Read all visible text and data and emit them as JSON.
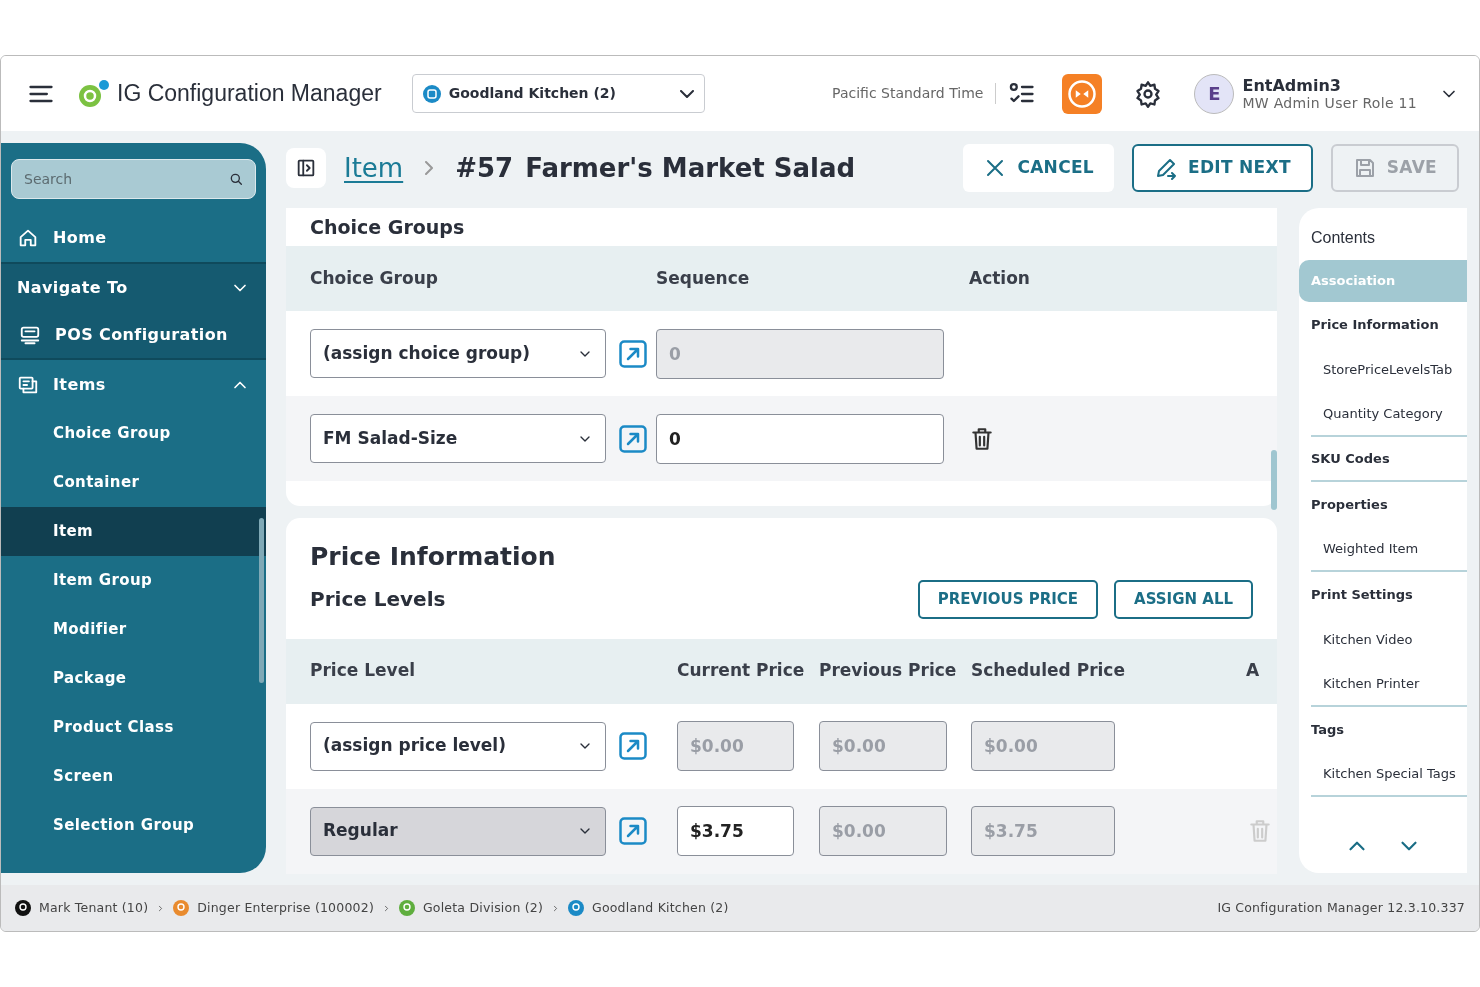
{
  "app": {
    "title": "IG Configuration Manager"
  },
  "location_select": {
    "value": "Goodland Kitchen (2)"
  },
  "timezone": "Pacific Standard Time",
  "user": {
    "initial": "E",
    "name": "EntAdmin3",
    "role": "MW Admin User Role 11"
  },
  "sidebar": {
    "search_placeholder": "Search",
    "items": [
      {
        "label": "Home",
        "kind": "home"
      },
      {
        "label": "Navigate To",
        "kind": "section",
        "expanded": false
      },
      {
        "label": "POS Configuration",
        "kind": "pos"
      },
      {
        "label": "Items",
        "kind": "group",
        "expanded": true,
        "children": [
          {
            "label": "Choice Group",
            "selected": false
          },
          {
            "label": "Container",
            "selected": false
          },
          {
            "label": "Item",
            "selected": true
          },
          {
            "label": "Item Group",
            "selected": false
          },
          {
            "label": "Modifier",
            "selected": false
          },
          {
            "label": "Package",
            "selected": false
          },
          {
            "label": "Product Class",
            "selected": false
          },
          {
            "label": "Screen",
            "selected": false
          },
          {
            "label": "Selection Group",
            "selected": false
          }
        ]
      }
    ]
  },
  "breadcrumb": {
    "parent": "Item",
    "number": "#57",
    "title": "Farmer's Market Salad"
  },
  "actions": [
    {
      "label": "CANCEL",
      "kind": "cancel",
      "disabled": false
    },
    {
      "label": "EDIT NEXT",
      "kind": "edit",
      "disabled": false
    },
    {
      "label": "SAVE",
      "kind": "save",
      "disabled": true
    }
  ],
  "choice_groups": {
    "title": "Choice Groups",
    "columns": [
      "Choice Group",
      "Sequence",
      "Action"
    ],
    "rows": [
      {
        "choice_group": "(assign choice group)",
        "sequence": "0",
        "sequence_disabled": true,
        "has_delete": false
      },
      {
        "choice_group": "FM Salad-Size",
        "sequence": "0",
        "sequence_disabled": false,
        "has_delete": true,
        "delete_disabled": false
      }
    ]
  },
  "price_information": {
    "title": "Price Information",
    "subtitle": "Price Levels",
    "buttons": [
      "PREVIOUS PRICE",
      "ASSIGN ALL"
    ],
    "columns": [
      "Price Level",
      "Current Price",
      "Previous Price",
      "Scheduled Price",
      "A"
    ],
    "rows": [
      {
        "price_level": "(assign price level)",
        "select_disabled": false,
        "current_price": "$0.00",
        "current_disabled": true,
        "previous_price": "$0.00",
        "scheduled_price": "$0.00",
        "has_delete": false
      },
      {
        "price_level": "Regular",
        "select_disabled": true,
        "current_price": "$3.75",
        "current_disabled": false,
        "previous_price": "$0.00",
        "scheduled_price": "$3.75",
        "has_delete": true,
        "delete_disabled": true
      }
    ]
  },
  "contents": {
    "title": "Contents",
    "items": [
      {
        "label": "Association",
        "kind": "section",
        "selected": true,
        "divider": false
      },
      {
        "label": "Price Information",
        "kind": "section",
        "selected": false,
        "divider": false
      },
      {
        "label": "StorePriceLevelsTab",
        "kind": "sub",
        "selected": false,
        "divider": false
      },
      {
        "label": "Quantity Category",
        "kind": "sub",
        "selected": false,
        "divider": true
      },
      {
        "label": "SKU Codes",
        "kind": "section",
        "selected": false,
        "divider": true
      },
      {
        "label": "Properties",
        "kind": "section",
        "selected": false,
        "divider": false
      },
      {
        "label": "Weighted Item",
        "kind": "sub",
        "selected": false,
        "divider": true
      },
      {
        "label": "Print Settings",
        "kind": "section",
        "selected": false,
        "divider": false
      },
      {
        "label": "Kitchen Video",
        "kind": "sub",
        "selected": false,
        "divider": false
      },
      {
        "label": "Kitchen Printer",
        "kind": "sub",
        "selected": false,
        "divider": true
      },
      {
        "label": "Tags",
        "kind": "section",
        "selected": false,
        "divider": false
      },
      {
        "label": "Kitchen Special Tags",
        "kind": "sub",
        "selected": false,
        "divider": true
      }
    ]
  },
  "status_bar": {
    "path": [
      {
        "label": "Mark Tenant (10)",
        "kind": "tenant"
      },
      {
        "label": "Dinger Enterprise (100002)",
        "kind": "enterprise"
      },
      {
        "label": "Goleta Division (2)",
        "kind": "division"
      },
      {
        "label": "Goodland Kitchen (2)",
        "kind": "store"
      }
    ],
    "version": "IG Configuration Manager 12.3.10.337"
  }
}
